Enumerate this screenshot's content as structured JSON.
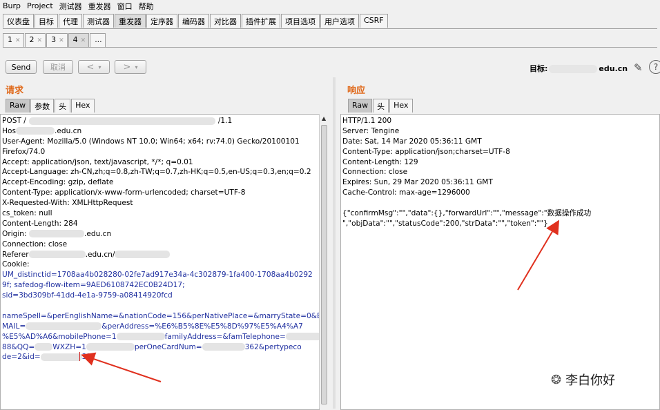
{
  "menu": [
    "Burp",
    "Project",
    "测试器",
    "重发器",
    "窗口",
    "帮助"
  ],
  "main_tabs": [
    {
      "label": "仪表盘"
    },
    {
      "label": "目标"
    },
    {
      "label": "代理"
    },
    {
      "label": "测试器"
    },
    {
      "label": "重发器",
      "active": true
    },
    {
      "label": "定序器"
    },
    {
      "label": "编码器"
    },
    {
      "label": "对比器"
    },
    {
      "label": "插件扩展"
    },
    {
      "label": "项目选项"
    },
    {
      "label": "用户选项"
    },
    {
      "label": "CSRF"
    }
  ],
  "sub_tabs": [
    {
      "label": "1"
    },
    {
      "label": "2"
    },
    {
      "label": "3"
    },
    {
      "label": "4",
      "active": true
    },
    {
      "label": "..."
    }
  ],
  "toolbar": {
    "send_label": "Send",
    "cancel_label": "取消",
    "back_label": "<",
    "forward_label": ">",
    "dropdown_label": "▾"
  },
  "target": {
    "label": "目标:",
    "host_suffix": "edu.cn",
    "help": "?"
  },
  "request": {
    "title": "请求",
    "tabs": [
      "Raw",
      "参数",
      "头",
      "Hex"
    ],
    "lines": [
      "POST /",
      "Hos",
      "User-Agent: Mozilla/5.0 (Windows NT 10.0; Win64; x64; rv:74.0) Gecko/20100101",
      "Firefox/74.0",
      "Accept: application/json, text/javascript, */*; q=0.01",
      "Accept-Language: zh-CN,zh;q=0.8,zh-TW;q=0.7,zh-HK;q=0.5,en-US;q=0.3,en;q=0.2",
      "Accept-Encoding: gzip, deflate",
      "Content-Type: application/x-www-form-urlencoded; charset=UTF-8",
      "X-Requested-With: XMLHttpRequest",
      "cs_token: null",
      "Content-Length: 284",
      "Origin: ",
      "Connection: close",
      "Referer",
      "Cookie:"
    ],
    "line1_suffix": "/1.1",
    "line2_suffix": ".edu.cn",
    "origin_suffix": ".edu.cn",
    "referer_suffix": ".edu.cn/",
    "cookie_lines": [
      "UM_distinctid=1708aa4b028280-02fe7ad917e34a-4c302879-1fa400-1708aa4b0292",
      "9f; safedog-flow-item=9AED6108742EC0B24D17;",
      "sid=3bd309bf-41dd-4e1a-9759-a08414920fcd"
    ],
    "body_lines": [
      "nameSpell=&perEnglishName=&nationCode=156&perNativePlace=&marryState=0&E",
      "MAIL=",
      "%E5%AD%A6&mobilePhone=1",
      "88&QQ=",
      "de=2&id="
    ],
    "body_fragments": {
      "mail_tail": "&perAddress=%E6%B5%8E%E5%8D%97%E5%A4%A7",
      "phone_tail": "familyAddress=&famTelephone=",
      "qq_mid": "WXZH=1",
      "qq_tail": "perOneCardNum=",
      "qq_end": "362&pertypeco",
      "id_end": "33"
    }
  },
  "response": {
    "title": "响应",
    "tabs": [
      "Raw",
      "头",
      "Hex"
    ],
    "lines": [
      "HTTP/1.1 200",
      "Server: Tengine",
      "Date: Sat, 14 Mar 2020 05:36:11 GMT",
      "Content-Type: application/json;charset=UTF-8",
      "Content-Length: 129",
      "Connection: close",
      "Expires: Sun, 29 Mar 2020 05:36:11 GMT",
      "Cache-Control: max-age=1296000",
      "",
      "{\"confirmMsg\":\"\",\"data\":{},\"forwardUrl\":\"\",\"message\":\"数据操作成功",
      "\",\"objData\":\"\",\"statusCode\":200,\"strData\":\"\",\"token\":\"\"}"
    ]
  },
  "watermark": "李白你好",
  "colors": {
    "section_title": "#e06a1c",
    "cookie_value": "#b0302a",
    "param_name": "#2030a0",
    "arrow": "#e0301e"
  }
}
